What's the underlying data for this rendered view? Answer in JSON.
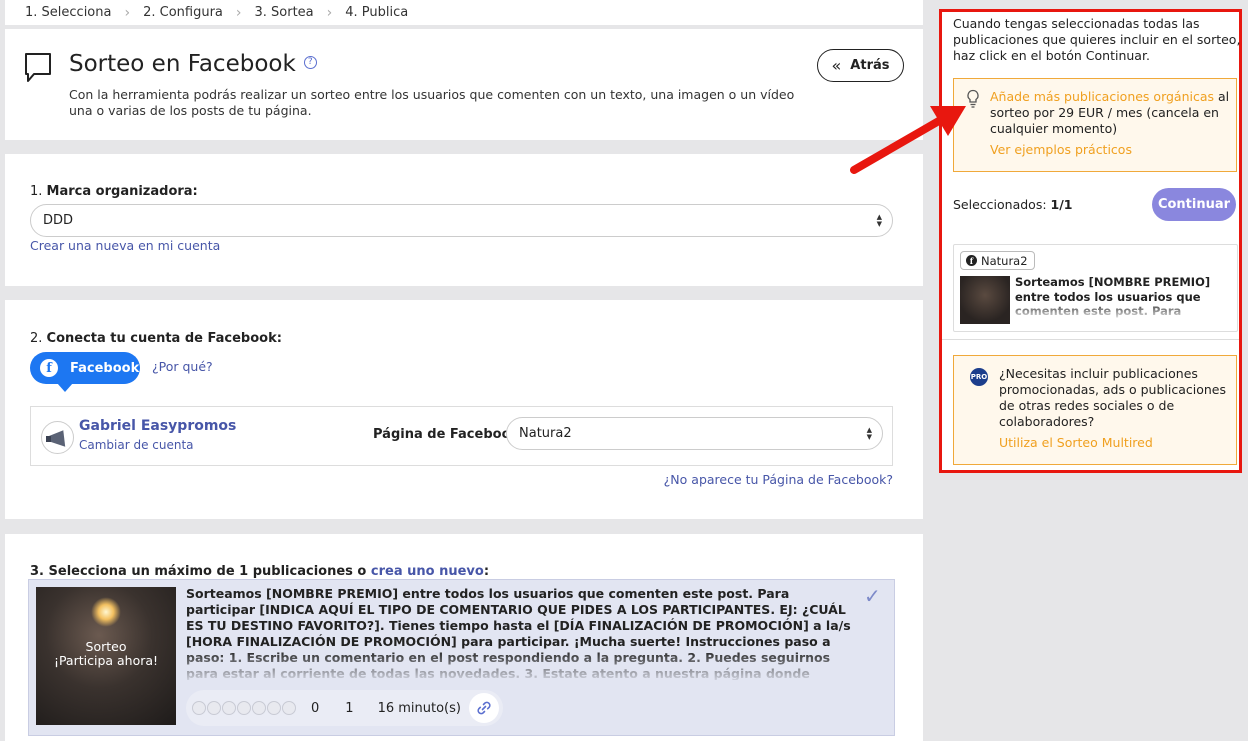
{
  "steps": [
    "1. Selecciona",
    "2. Configura",
    "3. Sortea",
    "4. Publica"
  ],
  "header": {
    "title": "Sorteo en Facebook",
    "help": "?",
    "description": "Con la herramienta podrás realizar un sorteo entre los usuarios que comenten con un texto, una imagen o un vídeo una o varias de los posts de tu página.",
    "back_label": "Atrás"
  },
  "section1": {
    "number": "1.",
    "label": "Marca organizadora:",
    "selected": "DDD",
    "create_link": "Crear una nueva en mi cuenta"
  },
  "section2": {
    "number": "2.",
    "label": "Conecta tu cuenta de Facebook:",
    "fb_button": "Facebook",
    "why_link": "¿Por qué?",
    "user_name": "Gabriel Easypromos",
    "change_account": "Cambiar de cuenta",
    "page_label": "Página de Facebook:",
    "page_selected": "Natura2",
    "missing_page_link": "¿No aparece tu Página de Facebook?"
  },
  "section3": {
    "label_prefix": "3. Selecciona un máximo de 1 publicaciones o ",
    "create_link": "crea uno nuevo",
    "label_suffix": ":",
    "post": {
      "thumb_title": "Sorteo",
      "thumb_subtitle": "¡Participa ahora!",
      "text": "Sorteamos [NOMBRE PREMIO] entre todos los usuarios que comenten este post. Para participar [INDICA AQUÍ EL TIPO DE COMENTARIO QUE PIDES A LOS PARTICIPANTES. EJ: ¿CUÁL ES TU DESTINO FAVORITO?]. Tienes tiempo hasta el [DÍA FINALIZACIÓN DE PROMOCIÓN] a la/s [HORA FINALIZACIÓN DE PROMOCIÓN] para participar. ¡Mucha suerte! Instrucciones paso a paso: 1. Escribe un comentario en el post respondiendo a la pregunta. 2. Puedes seguirnos para estar al corriente de todas las novedades. 3. Estate atento a nuestra página donde publicaremos al ganador/es. ¡Y recuerda que puedes compartir el",
      "reactions": "0",
      "comments": "1",
      "time": "16 minuto(s)"
    }
  },
  "right_panel": {
    "instructions": "Cuando tengas seleccionadas todas las publicaciones que quieres incluir en el sorteo, haz click en el botón Continuar.",
    "tip_link": "Añade más publicaciones orgánicas",
    "tip_text": " al sorteo por 29 EUR / mes (cancela en cualquier momento)",
    "tip_examples": "Ver ejemplos prácticos",
    "selected_prefix": "Seleccionados: ",
    "selected_count": "1/1",
    "continue_label": "Continuar",
    "selected_post": {
      "page": "Natura2",
      "text": "Sorteamos [NOMBRE PREMIO] entre todos los usuarios que comenten este post. Para participar [INDICA AQUÍ EL TIPO DE COMENTARIO"
    },
    "pro_badge": "PRO",
    "pro_text": "¿Necesitas incluir publicaciones promocionadas, ads o publicaciones de otras redes sociales o de colaboradores?",
    "pro_link": "Utiliza el Sorteo Multired"
  },
  "colors": {
    "accent_link": "#4756a8",
    "facebook_blue": "#1d77f2",
    "orange": "#f0a020",
    "highlight_red": "#e8170f",
    "continue_purple": "#8a87de"
  }
}
